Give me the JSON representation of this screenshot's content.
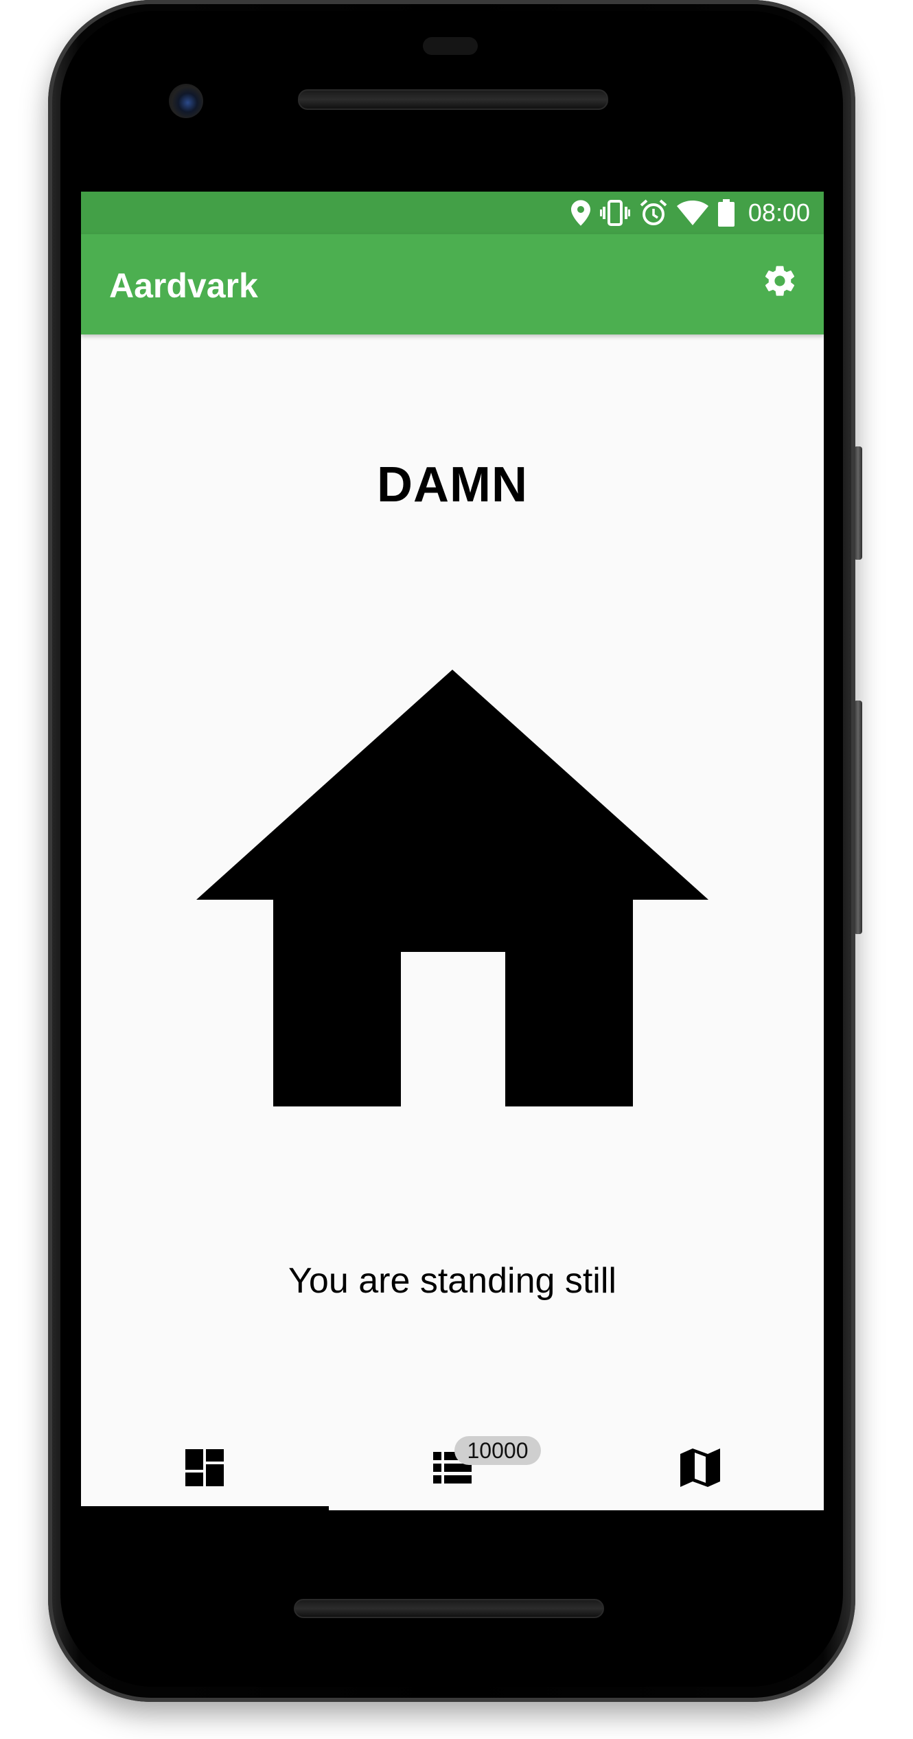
{
  "status_bar": {
    "time": "08:00",
    "icons": [
      "location-icon",
      "vibrate-icon",
      "alarm-icon",
      "wifi-icon",
      "battery-icon"
    ],
    "background": "#43a047"
  },
  "app_bar": {
    "title": "Aardvark",
    "action_icon": "settings-icon",
    "background": "#4caf50"
  },
  "main": {
    "headline": "DAMN",
    "illustration": "house-icon",
    "state_text": "You are standing still"
  },
  "bottom_nav": {
    "tabs": [
      {
        "icon": "dashboard-icon",
        "selected": true
      },
      {
        "icon": "list-icon",
        "badge": "10000",
        "selected": false
      },
      {
        "icon": "map-icon",
        "selected": false
      }
    ]
  }
}
